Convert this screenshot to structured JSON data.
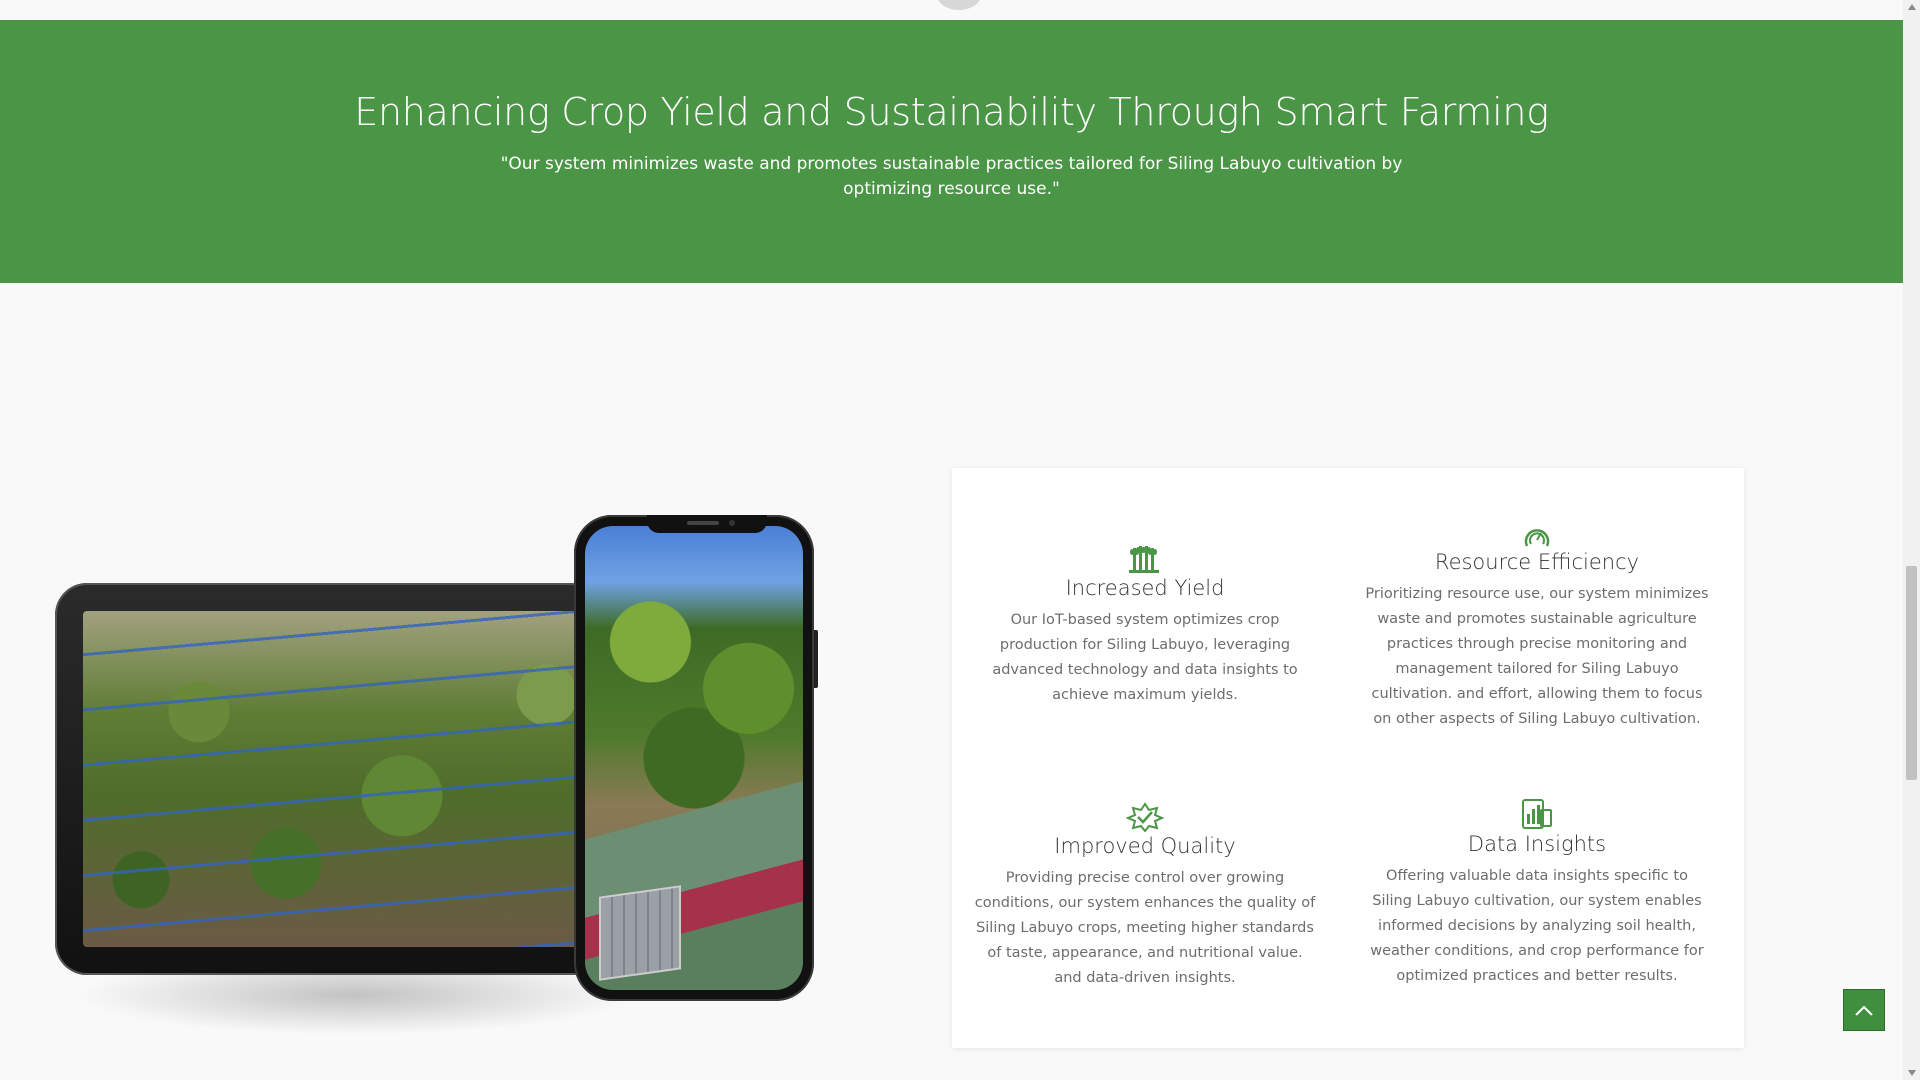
{
  "hero": {
    "title": "Enhancing Crop Yield and Sustainability Through Smart Farming",
    "subtitle": "\"Our system minimizes waste and promotes sustainable practices tailored for Siling Labuyo cultivation by optimizing resource use.\"",
    "background": "#4a9646"
  },
  "features": [
    {
      "icon": "wheat-icon",
      "title": "Increased Yield",
      "text": "Our IoT-based system optimizes crop production for Siling Labuyo, leveraging advanced technology and data insights to achieve maximum yields."
    },
    {
      "icon": "gauge-icon",
      "title": "Resource Efficiency",
      "text": "Prioritizing resource use, our system minimizes waste and promotes sustainable agriculture practices through precise monitoring and management tailored for Siling Labuyo cultivation. and effort, allowing them to focus on other aspects of Siling Labuyo cultivation."
    },
    {
      "icon": "quality-badge-icon",
      "title": "Improved Quality",
      "text": "Providing precise control over growing conditions, our system enhances the quality of Siling Labuyo crops, meeting higher standards of taste, appearance, and nutritional value. and data-driven insights."
    },
    {
      "icon": "analytics-device-icon",
      "title": "Data Insights",
      "text": "Offering valuable data insights specific to Siling Labuyo cultivation, our system enables informed decisions by analyzing soil health, weather conditions, and crop performance for optimized practices and better results."
    }
  ],
  "accent_color": "#4a9646",
  "scroll_top_icon": "chevron-up-icon"
}
